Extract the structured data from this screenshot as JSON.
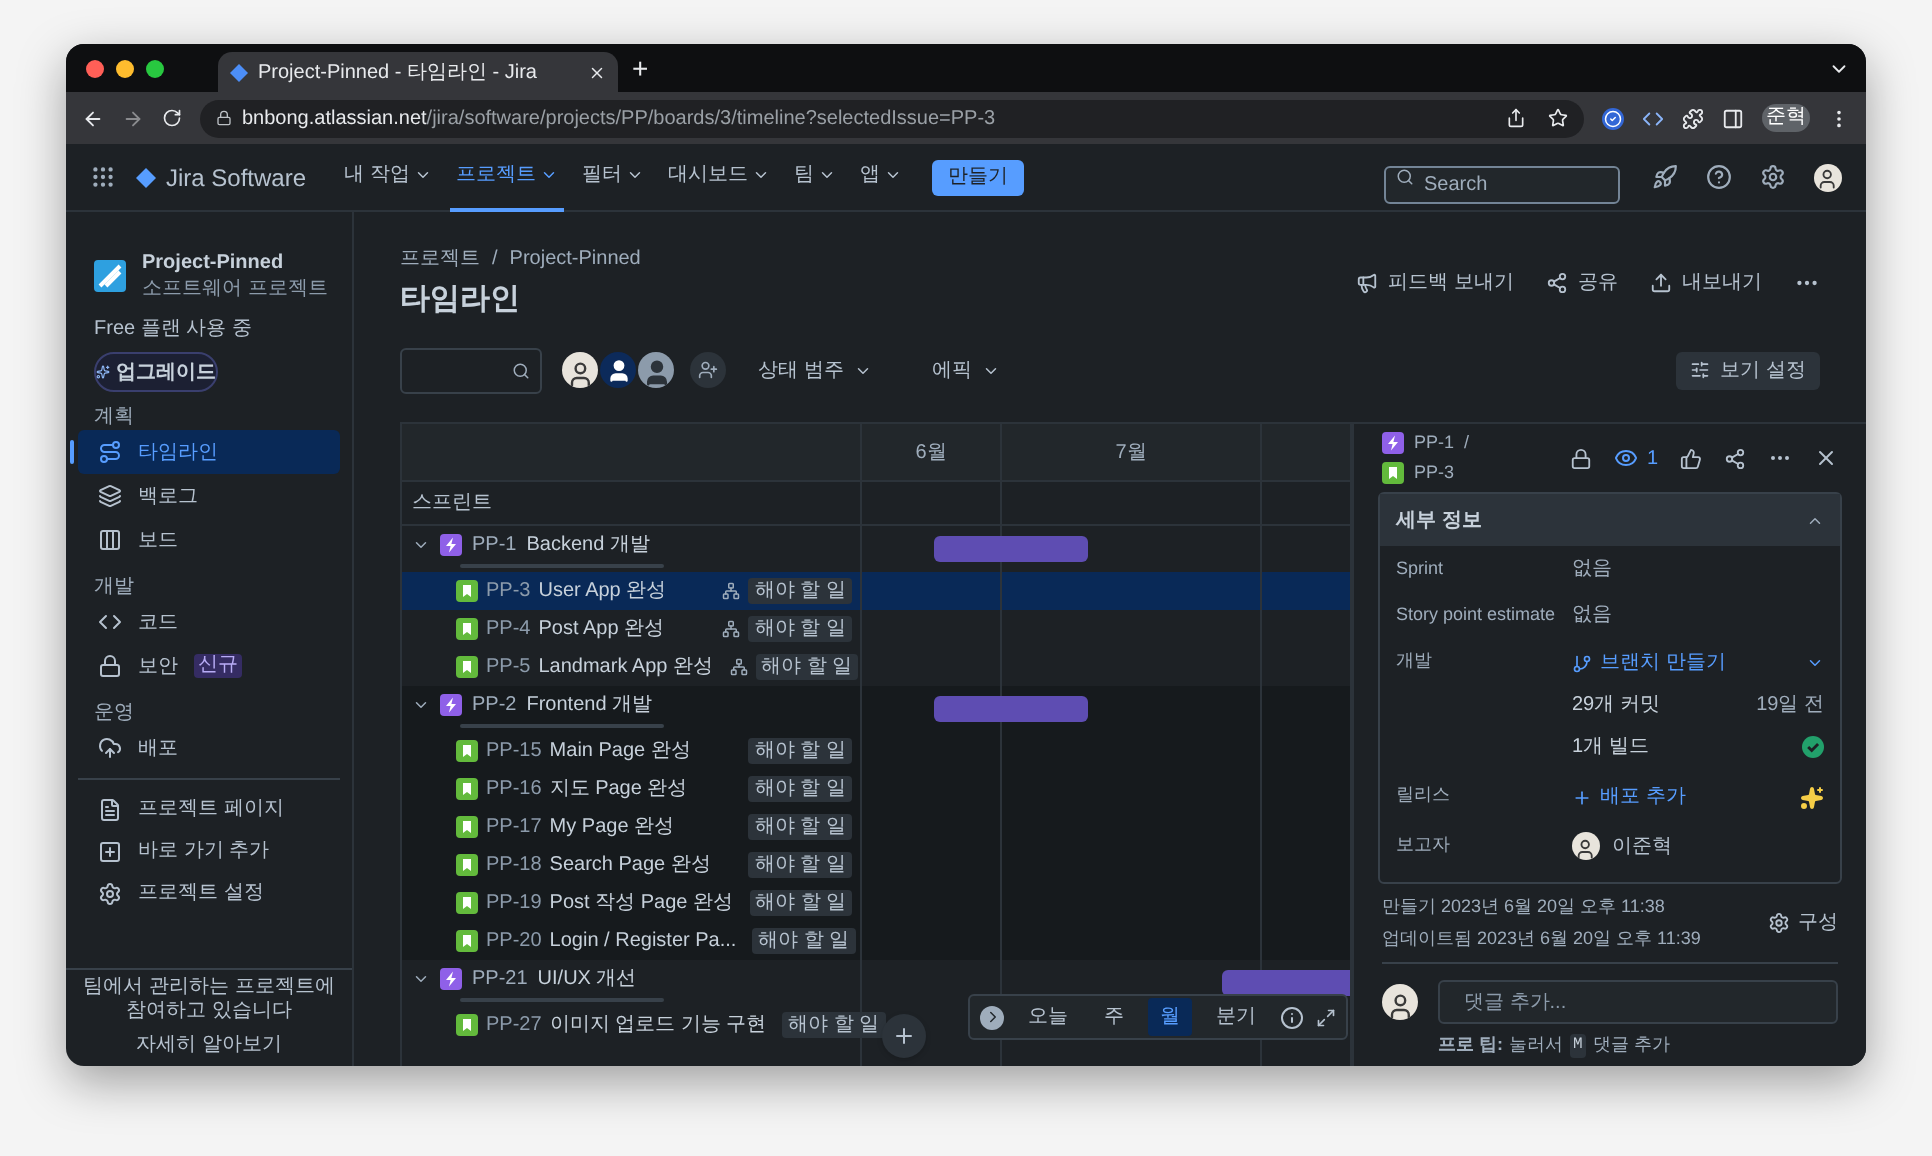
{
  "browser": {
    "tab_title": "Project-Pinned - 타임라인 - Jira",
    "new_tab": "+",
    "url_host": "bnbong.atlassian.net",
    "url_path": "/jira/software/projects/PP/boards/3/timeline?selectedIssue=PP-3",
    "profile": "준혁"
  },
  "nav": {
    "product": "Jira Software",
    "menus": [
      {
        "label": "내 작업",
        "selected": false
      },
      {
        "label": "프로젝트",
        "selected": true
      },
      {
        "label": "필터",
        "selected": false
      },
      {
        "label": "대시보드",
        "selected": false
      },
      {
        "label": "팀",
        "selected": false
      },
      {
        "label": "앱",
        "selected": false
      }
    ],
    "create": "만들기",
    "search_placeholder": "Search"
  },
  "sidebar": {
    "project_name": "Project-Pinned",
    "project_type": "소프트웨어 프로젝트",
    "plan": "Free 플랜 사용 중",
    "upgrade": "업그레이드",
    "sections": [
      {
        "title": "계획",
        "items": [
          {
            "kind": "timeline",
            "label": "타임라인",
            "selected": true
          },
          {
            "kind": "backlog",
            "label": "백로그",
            "selected": false
          },
          {
            "kind": "board",
            "label": "보드",
            "selected": false
          }
        ]
      },
      {
        "title": "개발",
        "items": [
          {
            "kind": "code",
            "label": "코드",
            "selected": false
          },
          {
            "kind": "security",
            "label": "보안",
            "badge": "신규",
            "selected": false
          }
        ]
      },
      {
        "title": "운영",
        "items": [
          {
            "kind": "deploy",
            "label": "배포",
            "selected": false
          }
        ]
      }
    ],
    "links": [
      {
        "kind": "page",
        "label": "프로젝트 페이지"
      },
      {
        "kind": "shortcut",
        "label": "바로 가기 추가"
      },
      {
        "kind": "settings",
        "label": "프로젝트 설정"
      }
    ],
    "footer_text": "팀에서 관리하는 프로젝트에 참여하고 있습니다",
    "footer_link": "자세히 알아보기"
  },
  "header": {
    "breadcrumb": [
      "프로젝트",
      "Project-Pinned"
    ],
    "separator": "/",
    "title": "타임라인",
    "actions": [
      {
        "kind": "feedback",
        "label": "피드백 보내기"
      },
      {
        "kind": "share",
        "label": "공유"
      },
      {
        "kind": "export",
        "label": "내보내기"
      }
    ]
  },
  "filters": {
    "items": [
      {
        "label": "상태 범주"
      },
      {
        "label": "에픽"
      }
    ],
    "view_settings": "보기 설정"
  },
  "timeline": {
    "months": [
      "6월",
      "7월"
    ],
    "sprint_label": "스프린트",
    "epics": [
      {
        "key": "PP-1",
        "title": "Backend 개발",
        "expanded": true,
        "bar": {
          "kind": "june-july"
        },
        "children": [
          {
            "key": "PP-3",
            "title": "User App 완성",
            "status": "해야 할 일",
            "has_subtasks": true,
            "selected": true
          },
          {
            "key": "PP-4",
            "title": "Post App 완성",
            "status": "해야 할 일",
            "has_subtasks": true,
            "selected": false
          },
          {
            "key": "PP-5",
            "title": "Landmark App 완성",
            "status": "해야 할 일",
            "has_subtasks": true,
            "selected": false
          }
        ]
      },
      {
        "key": "PP-2",
        "title": "Frontend 개발",
        "expanded": true,
        "bar": {
          "kind": "june-july"
        },
        "children": [
          {
            "key": "PP-15",
            "title": "Main Page 완성",
            "status": "해야 할 일",
            "has_subtasks": false,
            "selected": false
          },
          {
            "key": "PP-16",
            "title": "지도 Page 완성",
            "status": "해야 할 일",
            "has_subtasks": false,
            "selected": false
          },
          {
            "key": "PP-17",
            "title": "My Page 완성",
            "status": "해야 할 일",
            "has_subtasks": false,
            "selected": false
          },
          {
            "key": "PP-18",
            "title": "Search Page 완성",
            "status": "해야 할 일",
            "has_subtasks": false,
            "selected": false
          },
          {
            "key": "PP-19",
            "title": "Post 작성 Page 완성",
            "status": "해야 할 일",
            "has_subtasks": false,
            "selected": false
          },
          {
            "key": "PP-20",
            "title": "Login / Register Pa...",
            "status": "해야 할 일",
            "has_subtasks": false,
            "selected": false
          }
        ]
      },
      {
        "key": "PP-21",
        "title": "UI/UX 개선",
        "expanded": true,
        "bar": {
          "kind": "july-end"
        },
        "children": [
          {
            "key": "PP-27",
            "title": "이미지 업로드 기능 구현",
            "status": "해야 할 일",
            "has_subtasks": false,
            "selected": false
          }
        ]
      }
    ],
    "controls": {
      "today": "오늘",
      "scales": [
        {
          "label": "주",
          "selected": false
        },
        {
          "label": "월",
          "selected": true
        },
        {
          "label": "분기",
          "selected": false
        }
      ]
    }
  },
  "issue_panel": {
    "parent_key": "PP-1",
    "separator": "/",
    "key": "PP-3",
    "watchers": "1",
    "details_title": "세부 정보",
    "details_expanded": true,
    "fields": [
      {
        "kind": "text",
        "label": "Sprint",
        "value": "없음"
      },
      {
        "kind": "text",
        "label": "Story point estimate",
        "value": "없음"
      },
      {
        "kind": "development",
        "label": "개발",
        "action": "브랜치 만들기",
        "commits": "29개 커밋",
        "commits_time": "19일 전",
        "builds": "1개 빌드"
      },
      {
        "kind": "release",
        "label": "릴리스",
        "action": "배포 추가"
      },
      {
        "kind": "person",
        "label": "보고자",
        "value": "이준혁"
      }
    ],
    "created": "만들기 2023년 6월 20일 오후 11:38",
    "updated": "업데이트됨 2023년 6월 20일 오후 11:39",
    "configure": "구성",
    "comment_placeholder": "댓글 추가...",
    "tip_label": "프로 팁:",
    "tip_press": "눌러서",
    "tip_key": "M",
    "tip_action": "댓글 추가"
  }
}
